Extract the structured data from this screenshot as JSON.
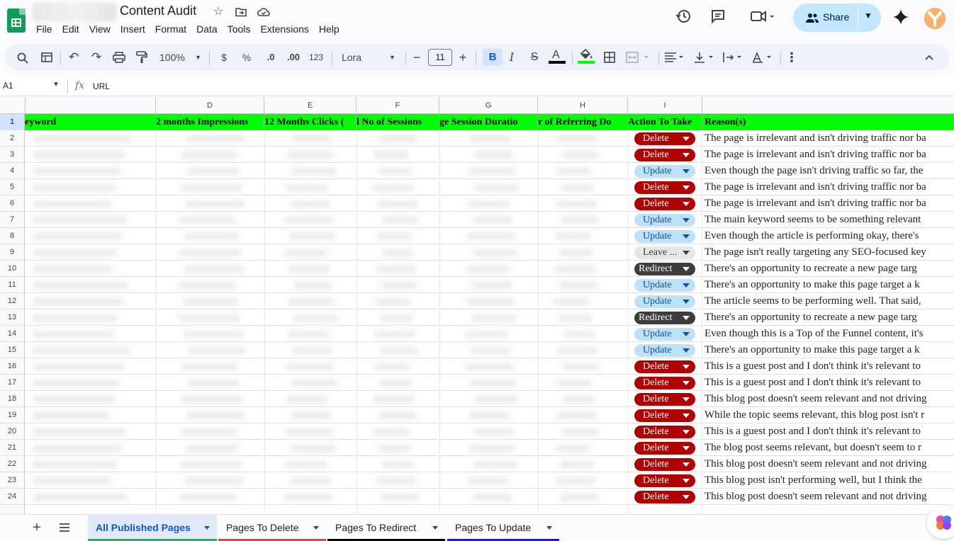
{
  "title": "Content Audit",
  "menu": [
    "File",
    "Edit",
    "View",
    "Insert",
    "Format",
    "Data",
    "Tools",
    "Extensions",
    "Help"
  ],
  "share_label": "Share",
  "toolbar": {
    "zoom": "100%",
    "currency": "$",
    "percent": "%",
    "dec_decrease": ".0",
    "dec_increase": ".00",
    "number_format": "123",
    "font": "Lora",
    "font_size": "11",
    "bold": "B",
    "italic": "I",
    "text_color_letter": "A",
    "text_color": "#000000",
    "fill_color": "#00ff00"
  },
  "formula_bar": {
    "cell_ref": "A1",
    "fx": "fx",
    "value": "URL"
  },
  "columns": [
    "D",
    "E",
    "F",
    "G",
    "H",
    "I"
  ],
  "header_row": {
    "keyword": "eyword",
    "impressions": "2 months Impressions",
    "clicks": "12 Months Clicks (",
    "sessions": "l No of Sessions",
    "duration": "ge Session Duratio",
    "referring": "r of Referring Do",
    "action": "Action To Take",
    "reason": "Reason(s)"
  },
  "row_numbers": [
    "1",
    "2",
    "3",
    "4",
    "5",
    "6",
    "7",
    "8",
    "9",
    "10",
    "11",
    "12",
    "13",
    "14",
    "15",
    "16",
    "17",
    "18",
    "19",
    "20",
    "21",
    "22",
    "23",
    "24"
  ],
  "rows": [
    {
      "action": "Delete",
      "type": "delete",
      "reason": "The page is irrelevant and isn't driving traffic nor ba"
    },
    {
      "action": "Delete",
      "type": "delete",
      "reason": "The page is irrelevant and isn't driving traffic nor ba"
    },
    {
      "action": "Update",
      "type": "update",
      "reason": "Even though the page isn't driving traffic so far, the"
    },
    {
      "action": "Delete",
      "type": "delete",
      "reason": "The page is irrelevant and isn't driving traffic nor ba"
    },
    {
      "action": "Delete",
      "type": "delete",
      "reason": "The page is irrelevant and isn't driving traffic nor ba"
    },
    {
      "action": "Update",
      "type": "update",
      "reason": "The main keyword seems to be something relevant"
    },
    {
      "action": "Update",
      "type": "update",
      "reason": "Even though the article is performing okay, there's"
    },
    {
      "action": "Leave ...",
      "type": "leave",
      "reason": "The page isn't really targeting any SEO-focused key"
    },
    {
      "action": "Redirect",
      "type": "redirect",
      "reason": "There's an opportunity to recreate a new page targ"
    },
    {
      "action": "Update",
      "type": "update",
      "reason": "There's an opportunity to make this page target a k"
    },
    {
      "action": "Update",
      "type": "update",
      "reason": "The article seems to be performing well. That said,"
    },
    {
      "action": "Redirect",
      "type": "redirect",
      "reason": "There's an opportunity to recreate a new page targ"
    },
    {
      "action": "Update",
      "type": "update",
      "reason": "Even though this is a Top of the Funnel content, it's"
    },
    {
      "action": "Update",
      "type": "update",
      "reason": "There's an opportunity to make this page target a k"
    },
    {
      "action": "Delete",
      "type": "delete",
      "reason": "This is a guest post and I don't think it's relevant to"
    },
    {
      "action": "Delete",
      "type": "delete",
      "reason": "This is a guest post and I don't think it's relevant to"
    },
    {
      "action": "Delete",
      "type": "delete",
      "reason": "This blog post doesn't seem relevant and not driving"
    },
    {
      "action": "Delete",
      "type": "delete",
      "reason": "While the topic seems relevant, this blog post isn't r"
    },
    {
      "action": "Delete",
      "type": "delete",
      "reason": "This is a guest post and I don't think it's relevant to"
    },
    {
      "action": "Delete",
      "type": "delete",
      "reason": "The blog post seems relevant, but doesn't seem to r"
    },
    {
      "action": "Delete",
      "type": "delete",
      "reason": "This blog post doesn't seem relevant and not driving"
    },
    {
      "action": "Delete",
      "type": "delete",
      "reason": "This blog post isn't performing well, but I think the"
    },
    {
      "action": "Delete",
      "type": "delete",
      "reason": "This blog post doesn't seem relevant and not driving"
    }
  ],
  "sheet_tabs": [
    {
      "label": "All Published Pages",
      "color": "#34a853",
      "active": true
    },
    {
      "label": "Pages To Delete",
      "color": "#ea4335",
      "active": false
    },
    {
      "label": "Pages To Redirect",
      "color": "#000000",
      "active": false
    },
    {
      "label": "Pages To Update",
      "color": "#1a1ad6",
      "active": false
    }
  ],
  "icons": {
    "star": "star-icon",
    "move": "folder-move-icon",
    "cloud": "cloud-saved-icon",
    "history": "history-icon",
    "comment": "comment-icon",
    "meet": "video-call-icon",
    "gemini": "gemini-sparkle-icon"
  }
}
